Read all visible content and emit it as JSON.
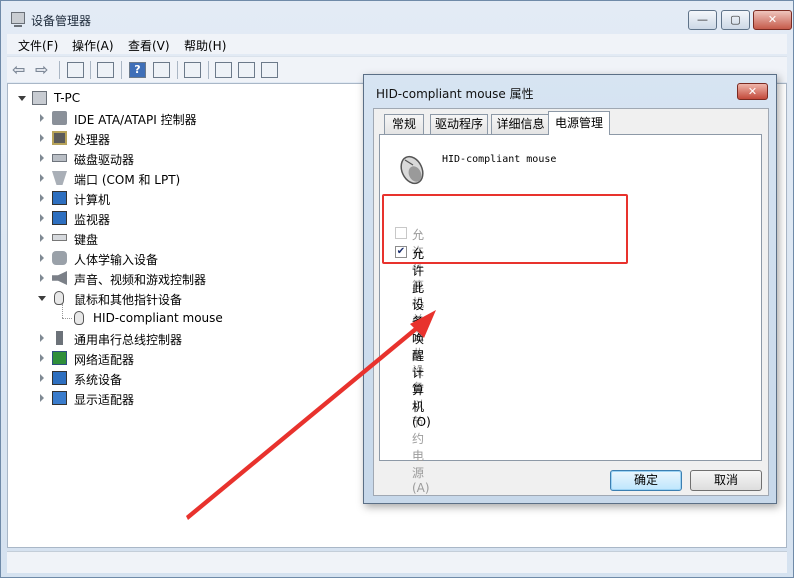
{
  "window": {
    "title": "设备管理器",
    "controls": {
      "minimize": "—",
      "maximize": "▢",
      "close": "✕"
    }
  },
  "menu": [
    "文件(F)",
    "操作(A)",
    "查看(V)",
    "帮助(H)"
  ],
  "toolbar_icons": [
    "back-icon",
    "forward-icon",
    "console-tree-icon",
    "properties-icon",
    "help-icon",
    "action-icon",
    "scan-hardware-icon",
    "update-driver-icon",
    "uninstall-icon",
    "disable-icon"
  ],
  "tree": {
    "root": "T-PC",
    "items": [
      {
        "label": "IDE ATA/ATAPI 控制器",
        "icon": "ide-controller-icon"
      },
      {
        "label": "处理器",
        "icon": "processor-icon"
      },
      {
        "label": "磁盘驱动器",
        "icon": "disk-drive-icon"
      },
      {
        "label": "端口 (COM 和 LPT)",
        "icon": "port-icon"
      },
      {
        "label": "计算机",
        "icon": "computer-icon"
      },
      {
        "label": "监视器",
        "icon": "monitor-icon"
      },
      {
        "label": "键盘",
        "icon": "keyboard-icon"
      },
      {
        "label": "人体学输入设备",
        "icon": "hid-icon"
      },
      {
        "label": "声音、视频和游戏控制器",
        "icon": "sound-icon"
      },
      {
        "label": "鼠标和其他指针设备",
        "icon": "mouse-icon",
        "expanded": true
      },
      {
        "label": "HID-compliant mouse",
        "icon": "mouse-icon",
        "child": true
      },
      {
        "label": "通用串行总线控制器",
        "icon": "usb-icon"
      },
      {
        "label": "网络适配器",
        "icon": "network-icon"
      },
      {
        "label": "系统设备",
        "icon": "system-device-icon"
      },
      {
        "label": "显示适配器",
        "icon": "display-adapter-icon"
      }
    ]
  },
  "dialog": {
    "title": "HID-compliant mouse 属性",
    "close": "✕",
    "tabs": [
      "常规",
      "驱动程序",
      "详细信息",
      "电源管理"
    ],
    "active_tab": "电源管理",
    "device_name": "HID-compliant mouse",
    "options": [
      {
        "label": "允许计算机关闭此设备以节约电源(A)",
        "checked": false,
        "enabled": false
      },
      {
        "label": "允许此设备唤醒计算机(O)",
        "checked": true,
        "enabled": true
      }
    ],
    "ok": "确定",
    "cancel": "取消"
  },
  "colors": {
    "annotation": "#e8322d",
    "titlebar": "#d5e2f0"
  }
}
